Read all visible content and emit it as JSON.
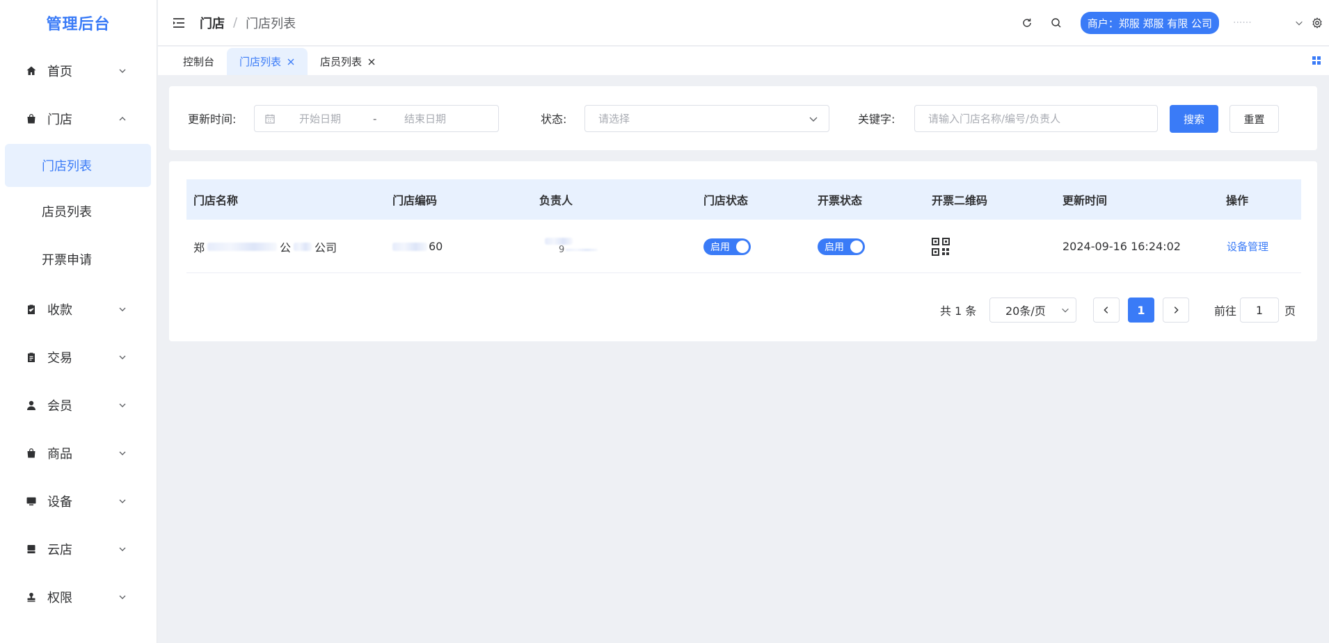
{
  "app": {
    "title": "管理后台"
  },
  "sidebar": {
    "items": [
      {
        "label": "首页",
        "icon": "home-icon",
        "expanded": false
      },
      {
        "label": "门店",
        "icon": "shop-bag-icon",
        "expanded": true,
        "children": [
          {
            "label": "门店列表",
            "active": true
          },
          {
            "label": "店员列表",
            "active": false
          },
          {
            "label": "开票申请",
            "active": false
          }
        ]
      },
      {
        "label": "收款",
        "icon": "clipboard-check-icon",
        "expanded": false
      },
      {
        "label": "交易",
        "icon": "clipboard-icon",
        "expanded": false
      },
      {
        "label": "会员",
        "icon": "user-icon",
        "expanded": false
      },
      {
        "label": "商品",
        "icon": "bag-icon",
        "expanded": false
      },
      {
        "label": "设备",
        "icon": "monitor-icon",
        "expanded": false
      },
      {
        "label": "云店",
        "icon": "store-icon",
        "expanded": false
      },
      {
        "label": "权限",
        "icon": "stamp-icon",
        "expanded": false
      }
    ]
  },
  "header": {
    "breadcrumb": [
      "门店",
      "门店列表"
    ],
    "merchant_label": "商户：郑服 郑服 有限 公司",
    "user_name": "······"
  },
  "tabs": [
    {
      "label": "控制台",
      "closable": false,
      "active": false
    },
    {
      "label": "门店列表",
      "closable": true,
      "active": true
    },
    {
      "label": "店员列表",
      "closable": true,
      "active": false
    }
  ],
  "filters": {
    "update_time_label": "更新时间:",
    "start_placeholder": "开始日期",
    "range_separator": "-",
    "end_placeholder": "结束日期",
    "status_label": "状态:",
    "status_placeholder": "请选择",
    "keyword_label": "关键字:",
    "keyword_placeholder": "请输入门店名称/编号/负责人",
    "search_button": "搜索",
    "reset_button": "重置"
  },
  "table": {
    "columns": [
      "门店名称",
      "门店编码",
      "负责人",
      "门店状态",
      "开票状态",
      "开票二维码",
      "更新时间",
      "操作"
    ],
    "rows": [
      {
        "name_start": "郑",
        "name_mid": "公",
        "name_end": "公司",
        "code_end": "60",
        "manager_end": "9",
        "store_status": "启用",
        "invoice_status": "启用",
        "updated": "2024-09-16 16:24:02",
        "action": "设备管理"
      }
    ]
  },
  "pagination": {
    "total_text": "共 1 条",
    "page_size": "20条/页",
    "current_page": "1",
    "goto_label": "前往",
    "goto_value": "1",
    "page_unit": "页"
  },
  "colors": {
    "primary": "#3a7bf7",
    "active_bg": "#e8f1fe",
    "page_bg": "#eef0f4"
  }
}
